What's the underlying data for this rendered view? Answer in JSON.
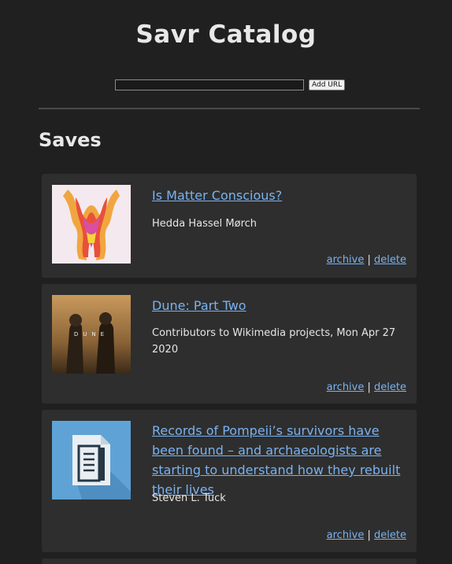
{
  "app": {
    "title": "Savr Catalog"
  },
  "form": {
    "url_value": "",
    "add_label": "Add URL"
  },
  "section": {
    "title": "Saves"
  },
  "saves": [
    {
      "title": "Is Matter Conscious?",
      "meta": "Hedda Hassel Mørch",
      "archive": "archive",
      "sep": "|",
      "delete": "delete"
    },
    {
      "title": "Dune: Part Two",
      "meta": "Contributors to Wikimedia projects, Mon Apr 27 2020",
      "thumb_text": "DUNE",
      "archive": "archive",
      "sep": "|",
      "delete": "delete"
    },
    {
      "title": "Records of Pompeii’s survivors have been found – and archaeologists are starting to understand how they rebuilt their lives",
      "meta": "Steven L. Tuck",
      "archive": "archive",
      "sep": "|",
      "delete": "delete"
    }
  ]
}
